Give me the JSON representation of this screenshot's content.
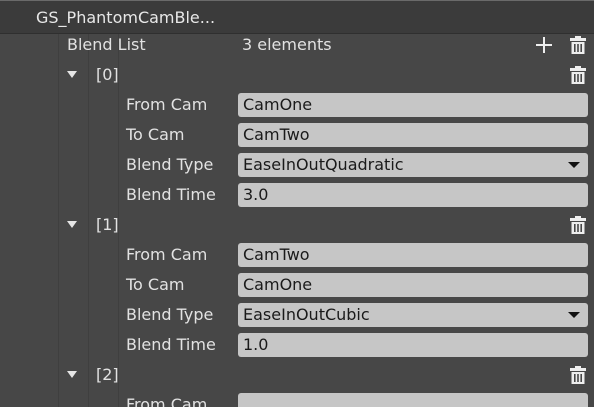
{
  "component": {
    "title": "GS_PhantomCamBle..."
  },
  "blend_list": {
    "label": "Blend List",
    "count": "3 elements",
    "icons": [
      "plus-icon",
      "trash-icon"
    ],
    "entries": [
      {
        "index": "[0]",
        "from_cam_label": "From Cam",
        "from_cam": "CamOne",
        "to_cam_label": "To Cam",
        "to_cam": "CamTwo",
        "blend_type_label": "Blend Type",
        "blend_type": "EaseInOutQuadratic",
        "blend_time_label": "Blend Time",
        "blend_time": "3.0"
      },
      {
        "index": "[1]",
        "from_cam_label": "From Cam",
        "from_cam": "CamTwo",
        "to_cam_label": "To Cam",
        "to_cam": "CamOne",
        "blend_type_label": "Blend Type",
        "blend_type": "EaseInOutCubic",
        "blend_time_label": "Blend Time",
        "blend_time": "1.0"
      },
      {
        "index": "[2]",
        "from_cam_label": "From Cam",
        "from_cam": ""
      }
    ]
  },
  "colors": {
    "panel_bg": "#474747",
    "header_bg": "#3b3b3b",
    "field_bg": "#c6c6c6",
    "text": "#e2e2e2"
  }
}
